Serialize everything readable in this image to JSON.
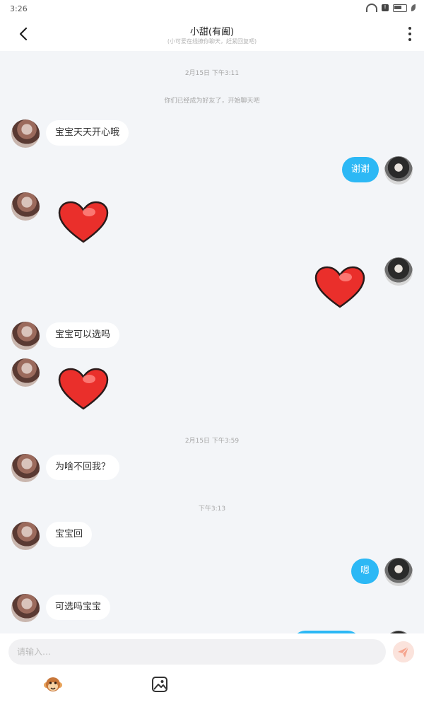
{
  "status_bar": {
    "time": "3:26"
  },
  "header": {
    "title": "小甜(有阖)",
    "subtitle": "(小可爱在线撩你聊天，赶紧回复吧)",
    "back_icon": "back-arrow-icon",
    "more_icon": "more-vertical-icon"
  },
  "chat": {
    "timestamps": [
      "2月15日 下午3:11",
      "2月15日 下午3:59",
      "下午3:13"
    ],
    "system_notice": "你们已经成为好友了，开始聊天吧",
    "messages": [
      {
        "from": "other",
        "text": "宝宝天天开心哦"
      },
      {
        "from": "me",
        "text": "谢谢"
      },
      {
        "from": "other",
        "sticker": "heart-sticker"
      },
      {
        "from": "me",
        "sticker": "heart-sticker"
      },
      {
        "from": "other",
        "text": "宝宝可以选吗"
      },
      {
        "from": "other",
        "sticker": "heart-sticker"
      },
      {
        "from": "other",
        "text": "为啥不回我？"
      },
      {
        "from": "other",
        "text": "宝宝回"
      },
      {
        "from": "me",
        "text": "嗯"
      },
      {
        "from": "other",
        "text": "可选吗宝宝"
      }
    ],
    "colors": {
      "outgoing_bubble": "#2cb8f5",
      "incoming_bubble": "#ffffff",
      "background": "#f3f5f8"
    }
  },
  "composer": {
    "placeholder": "请输入…",
    "send_icon": "send-icon",
    "tools": [
      "monkey-emoji-icon",
      "image-icon"
    ]
  }
}
